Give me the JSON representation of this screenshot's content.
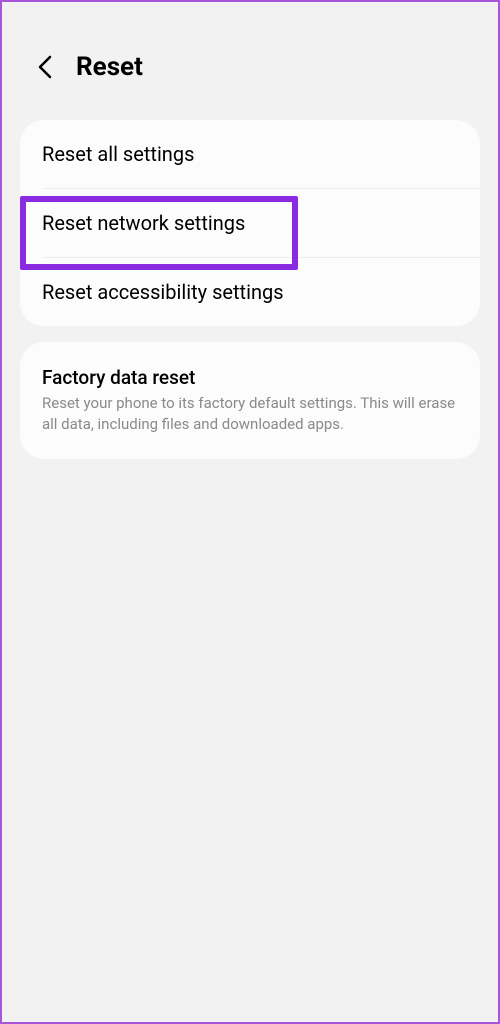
{
  "header": {
    "title": "Reset"
  },
  "section1": {
    "items": [
      {
        "title": "Reset all settings"
      },
      {
        "title": "Reset network settings"
      },
      {
        "title": "Reset accessibility settings"
      }
    ]
  },
  "section2": {
    "items": [
      {
        "title": "Factory data reset",
        "desc": "Reset your phone to its factory default settings. This will erase all data, including files and downloaded apps."
      }
    ]
  }
}
